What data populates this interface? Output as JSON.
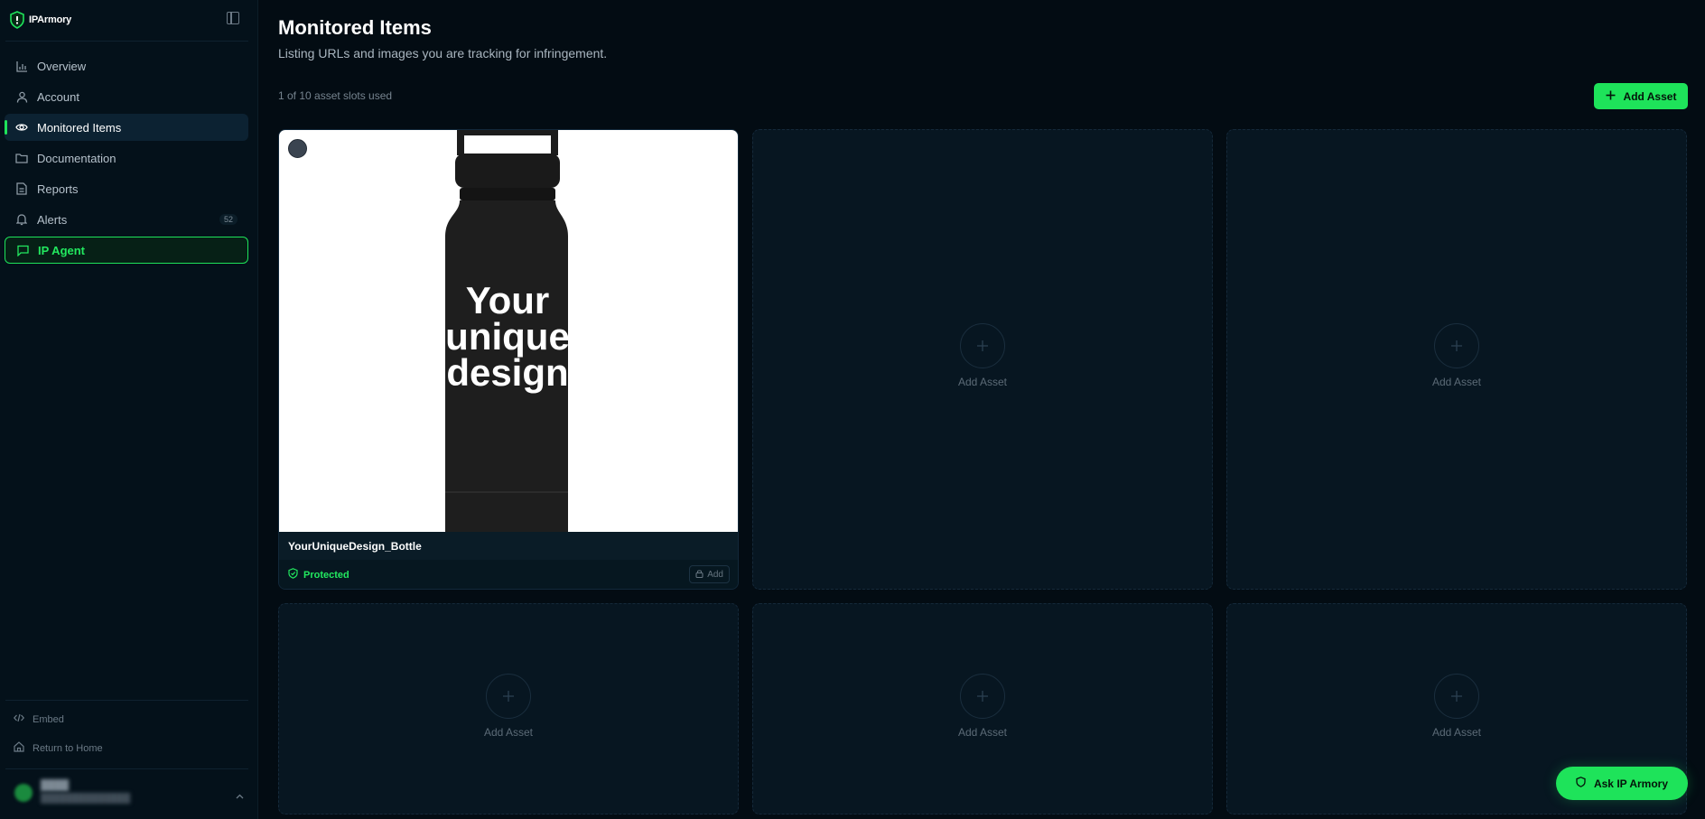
{
  "brand": {
    "name": "IPArmory"
  },
  "sidebar": {
    "items": [
      {
        "label": "Overview",
        "icon": "bar-chart-icon"
      },
      {
        "label": "Account",
        "icon": "user-icon"
      },
      {
        "label": "Monitored Items",
        "icon": "eye-icon",
        "active": true
      },
      {
        "label": "Documentation",
        "icon": "folder-icon"
      },
      {
        "label": "Reports",
        "icon": "document-icon"
      },
      {
        "label": "Alerts",
        "icon": "bell-icon",
        "badge": "52"
      },
      {
        "label": "IP Agent",
        "icon": "chat-icon",
        "highlight": true
      }
    ],
    "footer": {
      "embed": "Embed",
      "return_home": "Return to Home"
    }
  },
  "main": {
    "title": "Monitored Items",
    "subtitle": "Listing URLs and images you are tracking for infringement.",
    "slots_text": "1 of 10 asset slots used",
    "add_button": "Add Asset"
  },
  "asset": {
    "name": "YourUniqueDesign_Bottle",
    "status": "Protected",
    "lock_label": "Add",
    "image_text": [
      "Your",
      "unique",
      "design"
    ]
  },
  "empty_slot_label": "Add Asset",
  "ask_button": "Ask IP Armory",
  "colors": {
    "accent": "#1ee35a",
    "background": "#030c13",
    "sidebar": "#04111a"
  }
}
